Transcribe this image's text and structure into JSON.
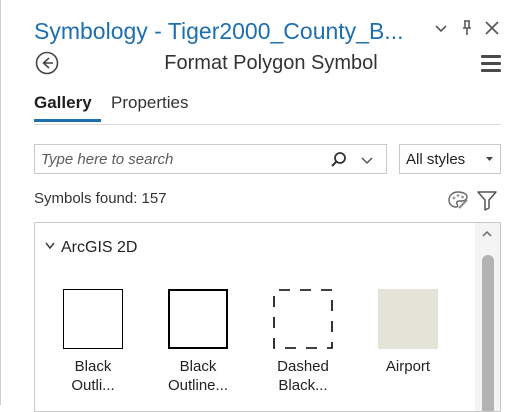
{
  "pane": {
    "title": "Symbology - Tiger2000_County_B...",
    "controls": {
      "dropdown": "⌄",
      "pin": "ᵖ",
      "close": "✕"
    }
  },
  "header": {
    "subtitle": "Format Polygon Symbol",
    "back_icon": "circle-arrow-left-icon",
    "menu_icon": "hamburger-menu-icon"
  },
  "tabs": [
    {
      "label": "Gallery",
      "active": true
    },
    {
      "label": "Properties",
      "active": false
    }
  ],
  "search": {
    "placeholder": "Type here to search",
    "style_filter": "All styles"
  },
  "results": {
    "found_text": "Symbols found: 157"
  },
  "gallery": {
    "group": "ArcGIS 2D",
    "symbols": [
      {
        "line1": "Black",
        "line2": "Outli..."
      },
      {
        "line1": "Black",
        "line2": "Outline..."
      },
      {
        "line1": "Dashed",
        "line2": "Black..."
      },
      {
        "line1": "Airport",
        "line2": ""
      }
    ]
  },
  "colors": {
    "accent": "#1d6fb0",
    "airport_fill": "#e4e3d7"
  }
}
